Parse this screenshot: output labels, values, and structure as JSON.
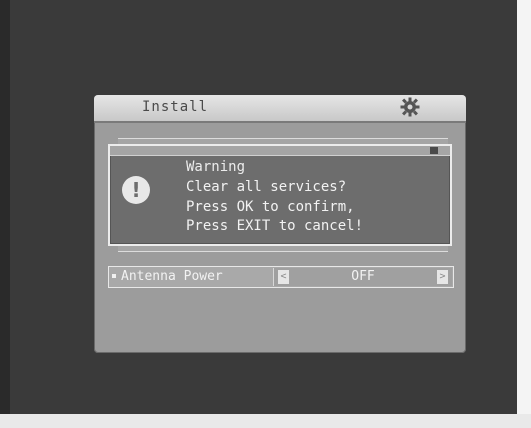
{
  "panel": {
    "title": "Install",
    "icon": "gear-icon"
  },
  "dialog": {
    "title": "Warning",
    "icon": "exclamation-icon",
    "lines": [
      "Clear all services?",
      "Press OK to confirm,",
      "Press EXIT to cancel!"
    ]
  },
  "menu": {
    "antenna_power": {
      "label": "Antenna Power",
      "value": "OFF",
      "left_arrow": "<",
      "right_arrow": ">"
    }
  },
  "colors": {
    "screen_bg": "#3a3a3a",
    "panel_bg": "#9c9c9c",
    "dialog_bg": "#6d6d6d"
  }
}
